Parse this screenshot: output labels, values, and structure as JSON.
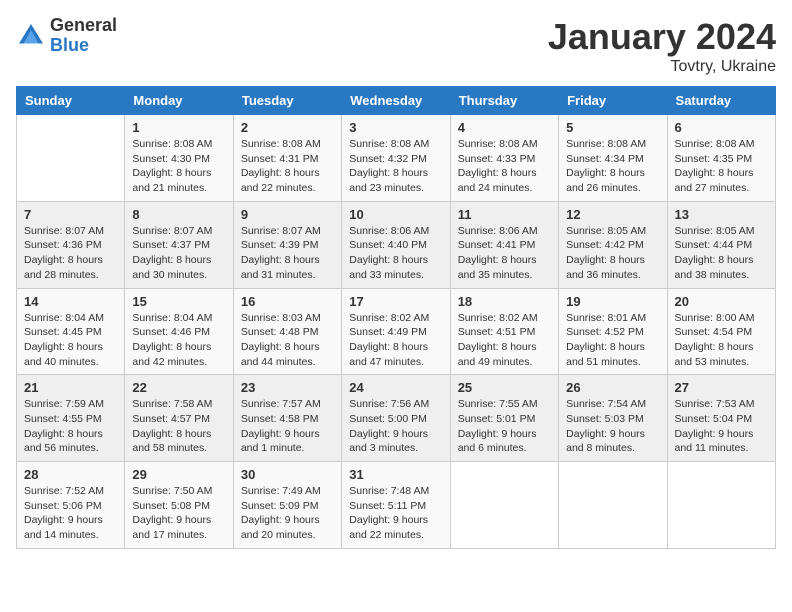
{
  "logo": {
    "general": "General",
    "blue": "Blue"
  },
  "title": "January 2024",
  "location": "Tovtry, Ukraine",
  "weekdays": [
    "Sunday",
    "Monday",
    "Tuesday",
    "Wednesday",
    "Thursday",
    "Friday",
    "Saturday"
  ],
  "weeks": [
    [
      {
        "day": "",
        "sunrise": "",
        "sunset": "",
        "daylight": ""
      },
      {
        "day": "1",
        "sunrise": "Sunrise: 8:08 AM",
        "sunset": "Sunset: 4:30 PM",
        "daylight": "Daylight: 8 hours and 21 minutes."
      },
      {
        "day": "2",
        "sunrise": "Sunrise: 8:08 AM",
        "sunset": "Sunset: 4:31 PM",
        "daylight": "Daylight: 8 hours and 22 minutes."
      },
      {
        "day": "3",
        "sunrise": "Sunrise: 8:08 AM",
        "sunset": "Sunset: 4:32 PM",
        "daylight": "Daylight: 8 hours and 23 minutes."
      },
      {
        "day": "4",
        "sunrise": "Sunrise: 8:08 AM",
        "sunset": "Sunset: 4:33 PM",
        "daylight": "Daylight: 8 hours and 24 minutes."
      },
      {
        "day": "5",
        "sunrise": "Sunrise: 8:08 AM",
        "sunset": "Sunset: 4:34 PM",
        "daylight": "Daylight: 8 hours and 26 minutes."
      },
      {
        "day": "6",
        "sunrise": "Sunrise: 8:08 AM",
        "sunset": "Sunset: 4:35 PM",
        "daylight": "Daylight: 8 hours and 27 minutes."
      }
    ],
    [
      {
        "day": "7",
        "sunrise": "Sunrise: 8:07 AM",
        "sunset": "Sunset: 4:36 PM",
        "daylight": "Daylight: 8 hours and 28 minutes."
      },
      {
        "day": "8",
        "sunrise": "Sunrise: 8:07 AM",
        "sunset": "Sunset: 4:37 PM",
        "daylight": "Daylight: 8 hours and 30 minutes."
      },
      {
        "day": "9",
        "sunrise": "Sunrise: 8:07 AM",
        "sunset": "Sunset: 4:39 PM",
        "daylight": "Daylight: 8 hours and 31 minutes."
      },
      {
        "day": "10",
        "sunrise": "Sunrise: 8:06 AM",
        "sunset": "Sunset: 4:40 PM",
        "daylight": "Daylight: 8 hours and 33 minutes."
      },
      {
        "day": "11",
        "sunrise": "Sunrise: 8:06 AM",
        "sunset": "Sunset: 4:41 PM",
        "daylight": "Daylight: 8 hours and 35 minutes."
      },
      {
        "day": "12",
        "sunrise": "Sunrise: 8:05 AM",
        "sunset": "Sunset: 4:42 PM",
        "daylight": "Daylight: 8 hours and 36 minutes."
      },
      {
        "day": "13",
        "sunrise": "Sunrise: 8:05 AM",
        "sunset": "Sunset: 4:44 PM",
        "daylight": "Daylight: 8 hours and 38 minutes."
      }
    ],
    [
      {
        "day": "14",
        "sunrise": "Sunrise: 8:04 AM",
        "sunset": "Sunset: 4:45 PM",
        "daylight": "Daylight: 8 hours and 40 minutes."
      },
      {
        "day": "15",
        "sunrise": "Sunrise: 8:04 AM",
        "sunset": "Sunset: 4:46 PM",
        "daylight": "Daylight: 8 hours and 42 minutes."
      },
      {
        "day": "16",
        "sunrise": "Sunrise: 8:03 AM",
        "sunset": "Sunset: 4:48 PM",
        "daylight": "Daylight: 8 hours and 44 minutes."
      },
      {
        "day": "17",
        "sunrise": "Sunrise: 8:02 AM",
        "sunset": "Sunset: 4:49 PM",
        "daylight": "Daylight: 8 hours and 47 minutes."
      },
      {
        "day": "18",
        "sunrise": "Sunrise: 8:02 AM",
        "sunset": "Sunset: 4:51 PM",
        "daylight": "Daylight: 8 hours and 49 minutes."
      },
      {
        "day": "19",
        "sunrise": "Sunrise: 8:01 AM",
        "sunset": "Sunset: 4:52 PM",
        "daylight": "Daylight: 8 hours and 51 minutes."
      },
      {
        "day": "20",
        "sunrise": "Sunrise: 8:00 AM",
        "sunset": "Sunset: 4:54 PM",
        "daylight": "Daylight: 8 hours and 53 minutes."
      }
    ],
    [
      {
        "day": "21",
        "sunrise": "Sunrise: 7:59 AM",
        "sunset": "Sunset: 4:55 PM",
        "daylight": "Daylight: 8 hours and 56 minutes."
      },
      {
        "day": "22",
        "sunrise": "Sunrise: 7:58 AM",
        "sunset": "Sunset: 4:57 PM",
        "daylight": "Daylight: 8 hours and 58 minutes."
      },
      {
        "day": "23",
        "sunrise": "Sunrise: 7:57 AM",
        "sunset": "Sunset: 4:58 PM",
        "daylight": "Daylight: 9 hours and 1 minute."
      },
      {
        "day": "24",
        "sunrise": "Sunrise: 7:56 AM",
        "sunset": "Sunset: 5:00 PM",
        "daylight": "Daylight: 9 hours and 3 minutes."
      },
      {
        "day": "25",
        "sunrise": "Sunrise: 7:55 AM",
        "sunset": "Sunset: 5:01 PM",
        "daylight": "Daylight: 9 hours and 6 minutes."
      },
      {
        "day": "26",
        "sunrise": "Sunrise: 7:54 AM",
        "sunset": "Sunset: 5:03 PM",
        "daylight": "Daylight: 9 hours and 8 minutes."
      },
      {
        "day": "27",
        "sunrise": "Sunrise: 7:53 AM",
        "sunset": "Sunset: 5:04 PM",
        "daylight": "Daylight: 9 hours and 11 minutes."
      }
    ],
    [
      {
        "day": "28",
        "sunrise": "Sunrise: 7:52 AM",
        "sunset": "Sunset: 5:06 PM",
        "daylight": "Daylight: 9 hours and 14 minutes."
      },
      {
        "day": "29",
        "sunrise": "Sunrise: 7:50 AM",
        "sunset": "Sunset: 5:08 PM",
        "daylight": "Daylight: 9 hours and 17 minutes."
      },
      {
        "day": "30",
        "sunrise": "Sunrise: 7:49 AM",
        "sunset": "Sunset: 5:09 PM",
        "daylight": "Daylight: 9 hours and 20 minutes."
      },
      {
        "day": "31",
        "sunrise": "Sunrise: 7:48 AM",
        "sunset": "Sunset: 5:11 PM",
        "daylight": "Daylight: 9 hours and 22 minutes."
      },
      {
        "day": "",
        "sunrise": "",
        "sunset": "",
        "daylight": ""
      },
      {
        "day": "",
        "sunrise": "",
        "sunset": "",
        "daylight": ""
      },
      {
        "day": "",
        "sunrise": "",
        "sunset": "",
        "daylight": ""
      }
    ]
  ]
}
